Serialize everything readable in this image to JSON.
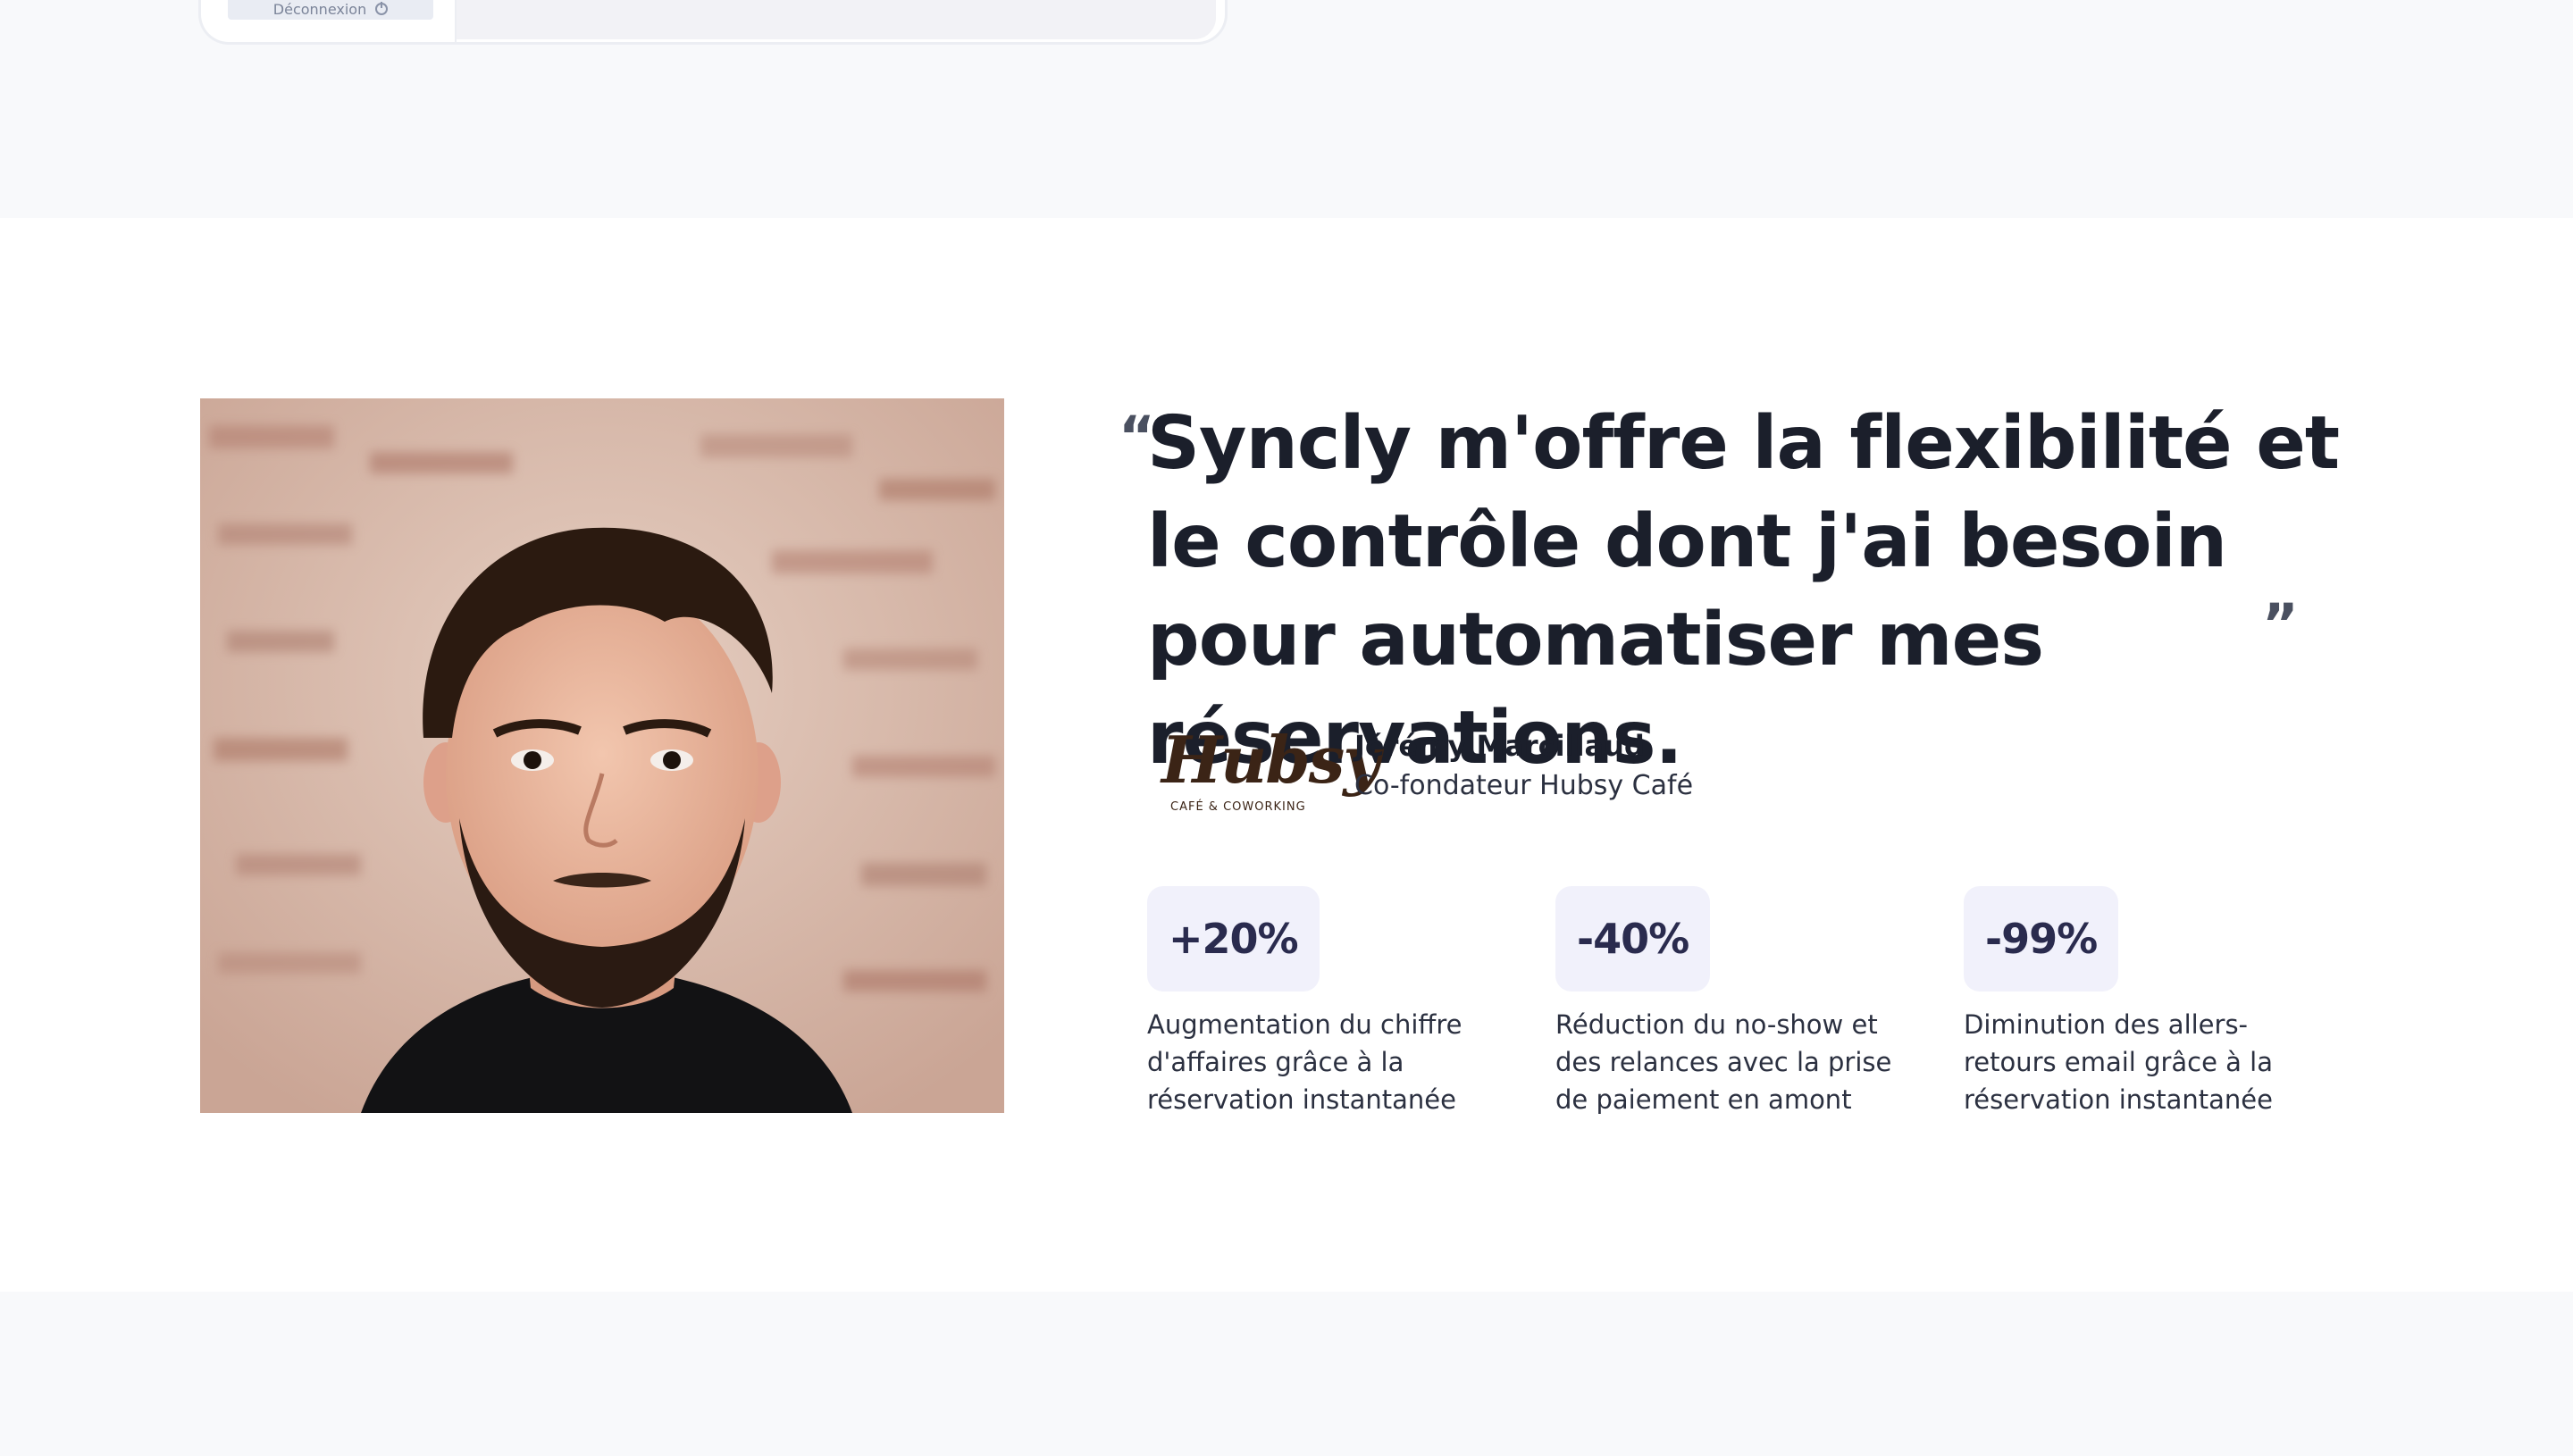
{
  "mockup": {
    "logout_label": "Déconnexion"
  },
  "testimonial": {
    "quote_open": "“",
    "quote_close": "”",
    "quote": "Syncly m'offre la flexibilité et le contrôle dont j'ai besoin pour automatiser mes réservations.",
    "photo_alt": "Portrait de Jérémy Marcillaud",
    "logo": {
      "word": "Hubsy",
      "tagline": "CAFÉ & COWORKING"
    },
    "author": {
      "name": "Jérémy Marcillaud",
      "role": "Co-fondateur Hubsy Café"
    },
    "stats": [
      {
        "value": "+20%",
        "description": "Augmentation du chiffre d'affaires grâce à la réservation instantanée"
      },
      {
        "value": "-40%",
        "description": "Réduction du no-show et des relances avec la prise de paiement en amont"
      },
      {
        "value": "-99%",
        "description": "Diminution des allers-retours email grâce à la réservation instantanée"
      }
    ]
  },
  "colors": {
    "page_bg": "#f8f9fb",
    "section_bg": "#ffffff",
    "heading": "#1b1f2b",
    "badge_bg": "#f1f1fb",
    "badge_text": "#2a2b4e",
    "logo_brown": "#3b2416"
  }
}
